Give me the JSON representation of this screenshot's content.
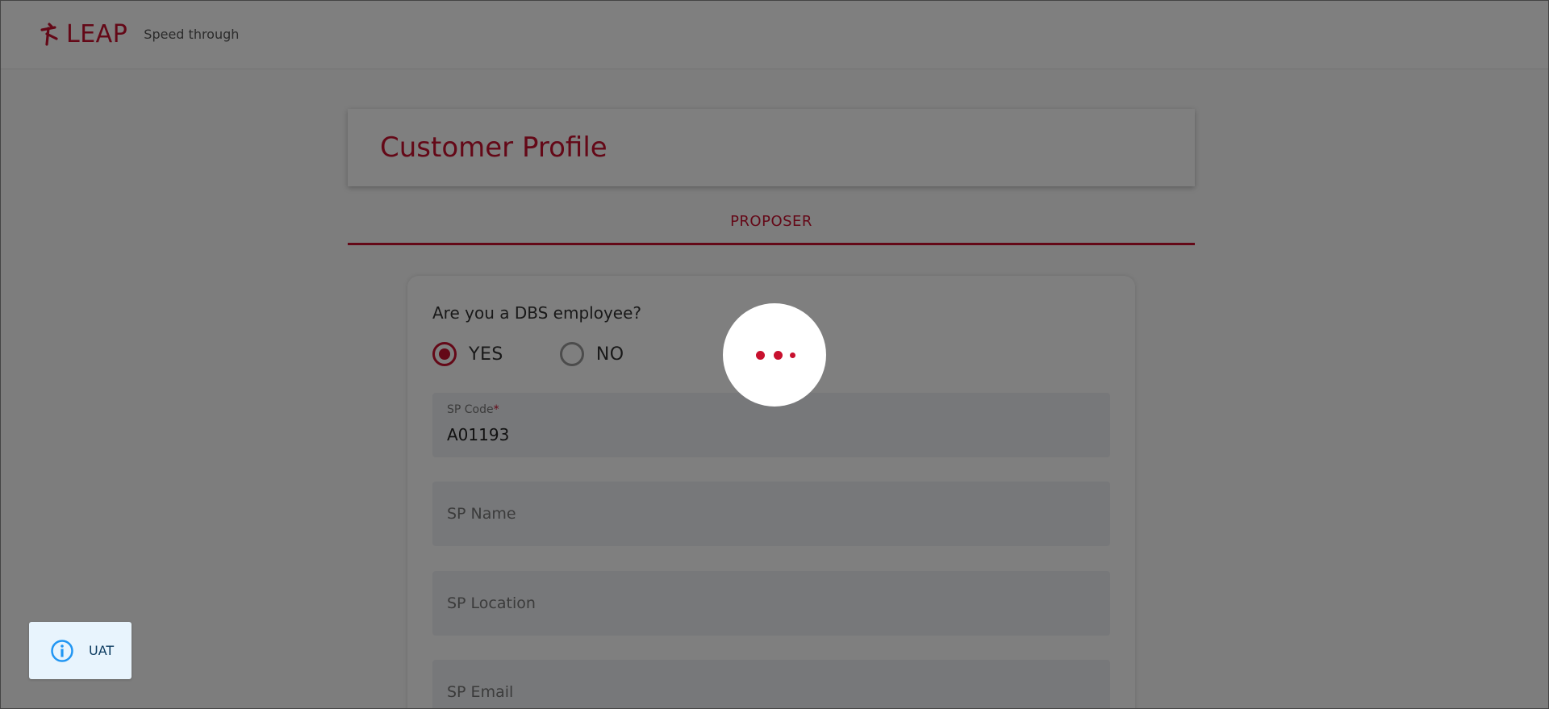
{
  "header": {
    "logo_text": "LEAP",
    "tagline": "Speed through",
    "brand_color": "#c8102e"
  },
  "profile": {
    "title": "Customer Profile"
  },
  "tabs": [
    {
      "label": "PROPOSER",
      "active": true
    }
  ],
  "form": {
    "question": "Are you a DBS employee?",
    "options": [
      {
        "label": "YES",
        "selected": true
      },
      {
        "label": "NO",
        "selected": false
      }
    ],
    "fields": [
      {
        "label": "SP Code",
        "required": "*",
        "value": "A01193"
      },
      {
        "placeholder": "SP Name"
      },
      {
        "placeholder": "SP Location"
      },
      {
        "placeholder": "SP Email"
      }
    ]
  },
  "loading": {
    "icon": "loading-dots-icon"
  },
  "env_badge": {
    "icon": "info-icon",
    "label": "UAT",
    "color": "#2196f3"
  }
}
